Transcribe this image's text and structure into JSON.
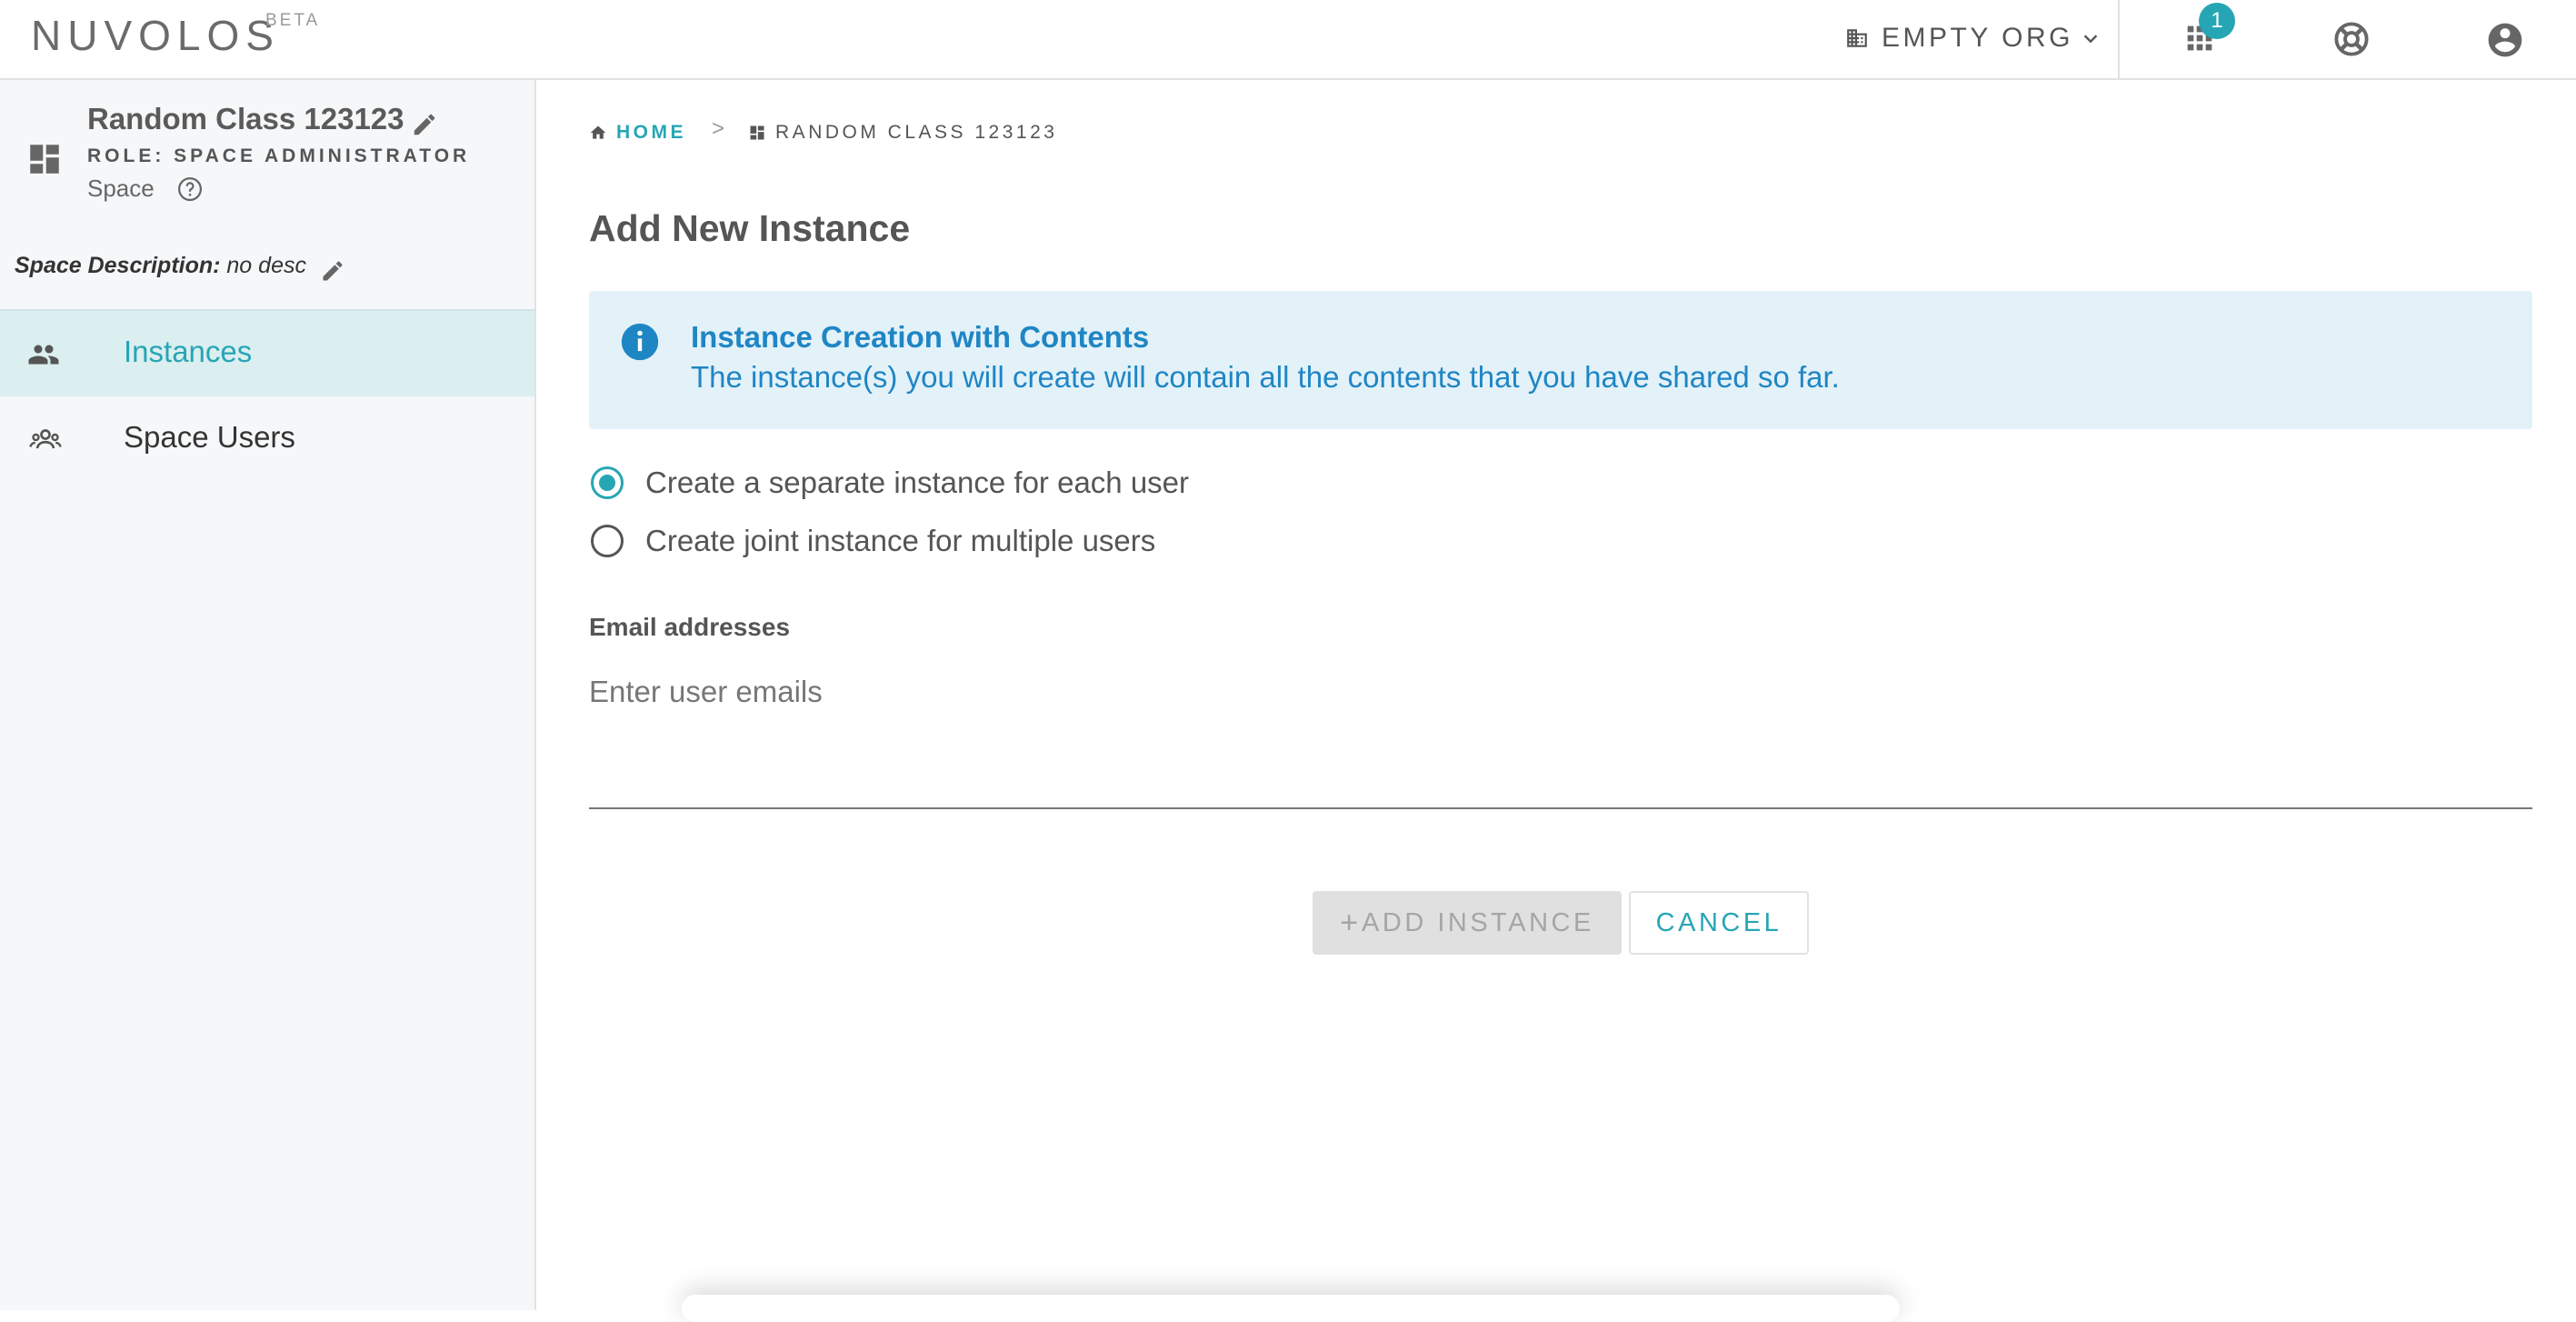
{
  "header": {
    "brand": "NUVOLOS",
    "brand_sup": "BETA",
    "org_name": "EMPTY ORG",
    "apps_badge": "1",
    "icons": [
      "building-icon",
      "chevron-down-icon",
      "apps-grid-icon",
      "lifebuoy-icon",
      "account-circle-icon"
    ]
  },
  "sidebar": {
    "space_name": "Random Class 123123",
    "role": "ROLE: SPACE ADMINISTRATOR",
    "type": "Space",
    "description_label": "Space Description:",
    "description_value": "no desc",
    "nav": [
      {
        "label": "Instances",
        "icon": "group-icon",
        "active": true
      },
      {
        "label": "Space Users",
        "icon": "users-icon",
        "active": false
      }
    ]
  },
  "main": {
    "breadcrumb": {
      "home": "HOME",
      "separator": ">",
      "current": "RANDOM CLASS 123123"
    },
    "title": "Add New Instance",
    "alert": {
      "title": "Instance Creation with Contents",
      "text": "The instance(s) you will create will contain all the contents that you have shared so far."
    },
    "options": [
      {
        "label": "Create a separate instance for each user",
        "checked": true
      },
      {
        "label": "Create joint instance for multiple users",
        "checked": false
      }
    ],
    "email_label": "Email addresses",
    "email_placeholder": "Enter user emails",
    "email_value": "",
    "add_button": "ADD INSTANCE",
    "add_button_icon": "+",
    "cancel_button": "CANCEL"
  },
  "colors": {
    "accent": "#26a6b5",
    "info_blue": "#1f86c4",
    "info_bg": "#e3f1f9",
    "sidebar_bg": "#f5f7f9",
    "active_nav_bg": "#dbeef0"
  }
}
